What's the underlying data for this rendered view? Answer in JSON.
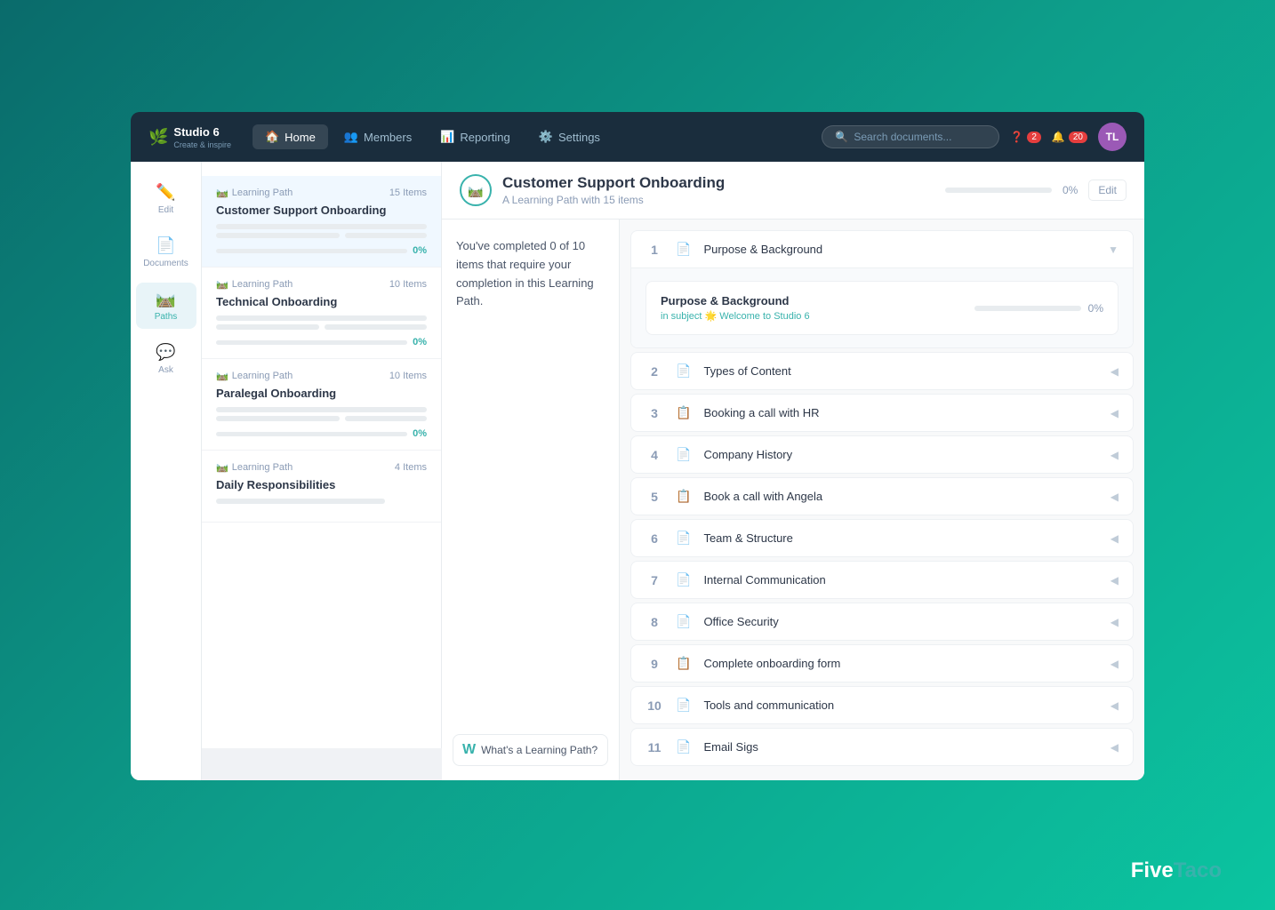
{
  "app": {
    "logo": "🌿",
    "name": "Studio 6",
    "tagline": "Create & inspire"
  },
  "navbar": {
    "items": [
      {
        "id": "home",
        "label": "Home",
        "icon": "🏠",
        "active": true
      },
      {
        "id": "members",
        "label": "Members",
        "icon": "👥",
        "active": false
      },
      {
        "id": "reporting",
        "label": "Reporting",
        "icon": "📊",
        "active": false
      },
      {
        "id": "settings",
        "label": "Settings",
        "icon": "⚙️",
        "active": false
      }
    ],
    "search_placeholder": "Search documents...",
    "help_count": "2",
    "notif_count": "20",
    "avatar_initials": "TL"
  },
  "sidebar": {
    "items": [
      {
        "id": "edit",
        "label": "Edit",
        "icon": "✏️",
        "active": false
      },
      {
        "id": "documents",
        "label": "Documents",
        "icon": "📄",
        "active": false
      },
      {
        "id": "paths",
        "label": "Paths",
        "icon": "🛤️",
        "active": true
      },
      {
        "id": "ask",
        "label": "Ask",
        "icon": "💬",
        "active": false
      }
    ]
  },
  "paths_list": {
    "items": [
      {
        "id": "customer-support",
        "type": "Learning Path",
        "count": "15 Items",
        "title": "Customer Support Onboarding",
        "active": true
      },
      {
        "id": "technical",
        "type": "Learning Path",
        "count": "10 Items",
        "title": "Technical Onboarding",
        "active": false
      },
      {
        "id": "paralegal",
        "type": "Learning Path",
        "count": "10 Items",
        "title": "Paralegal Onboarding",
        "active": false
      },
      {
        "id": "daily",
        "type": "Learning Path",
        "count": "4 Items",
        "title": "Daily Responsibilities",
        "active": false
      }
    ]
  },
  "content": {
    "title": "Customer Support Onboarding",
    "subtitle": "A Learning Path with 15 items",
    "progress_pct": "0%",
    "edit_label": "Edit",
    "info_text": "You've completed 0 of 10 items that require your completion in this Learning Path.",
    "whats_label": "What's a Learning Path?"
  },
  "learning_items": [
    {
      "num": "1",
      "icon": "doc",
      "name": "Purpose & Background",
      "expanded": true
    },
    {
      "num": "2",
      "icon": "doc",
      "name": "Types of Content",
      "expanded": false
    },
    {
      "num": "3",
      "icon": "cal",
      "name": "Booking a call with HR",
      "expanded": false
    },
    {
      "num": "4",
      "icon": "doc",
      "name": "Company History",
      "expanded": false
    },
    {
      "num": "5",
      "icon": "cal",
      "name": "Book a call with Angela",
      "expanded": false
    },
    {
      "num": "6",
      "icon": "doc",
      "name": "Team & Structure",
      "expanded": false
    },
    {
      "num": "7",
      "icon": "doc",
      "name": "Internal Communication",
      "expanded": false
    },
    {
      "num": "8",
      "icon": "doc",
      "name": "Office Security",
      "expanded": false
    },
    {
      "num": "9",
      "icon": "cal",
      "name": "Complete onboarding form",
      "expanded": false
    },
    {
      "num": "10",
      "icon": "doc",
      "name": "Tools and communication",
      "expanded": false
    },
    {
      "num": "11",
      "icon": "doc",
      "name": "Email Sigs",
      "expanded": false
    }
  ],
  "expanded_item": {
    "title": "Purpose & Background",
    "subject_label": "in subject 🌟 Welcome to Studio 6",
    "progress_pct": "0%"
  },
  "branding": {
    "five": "Five",
    "taco": "Taco"
  }
}
